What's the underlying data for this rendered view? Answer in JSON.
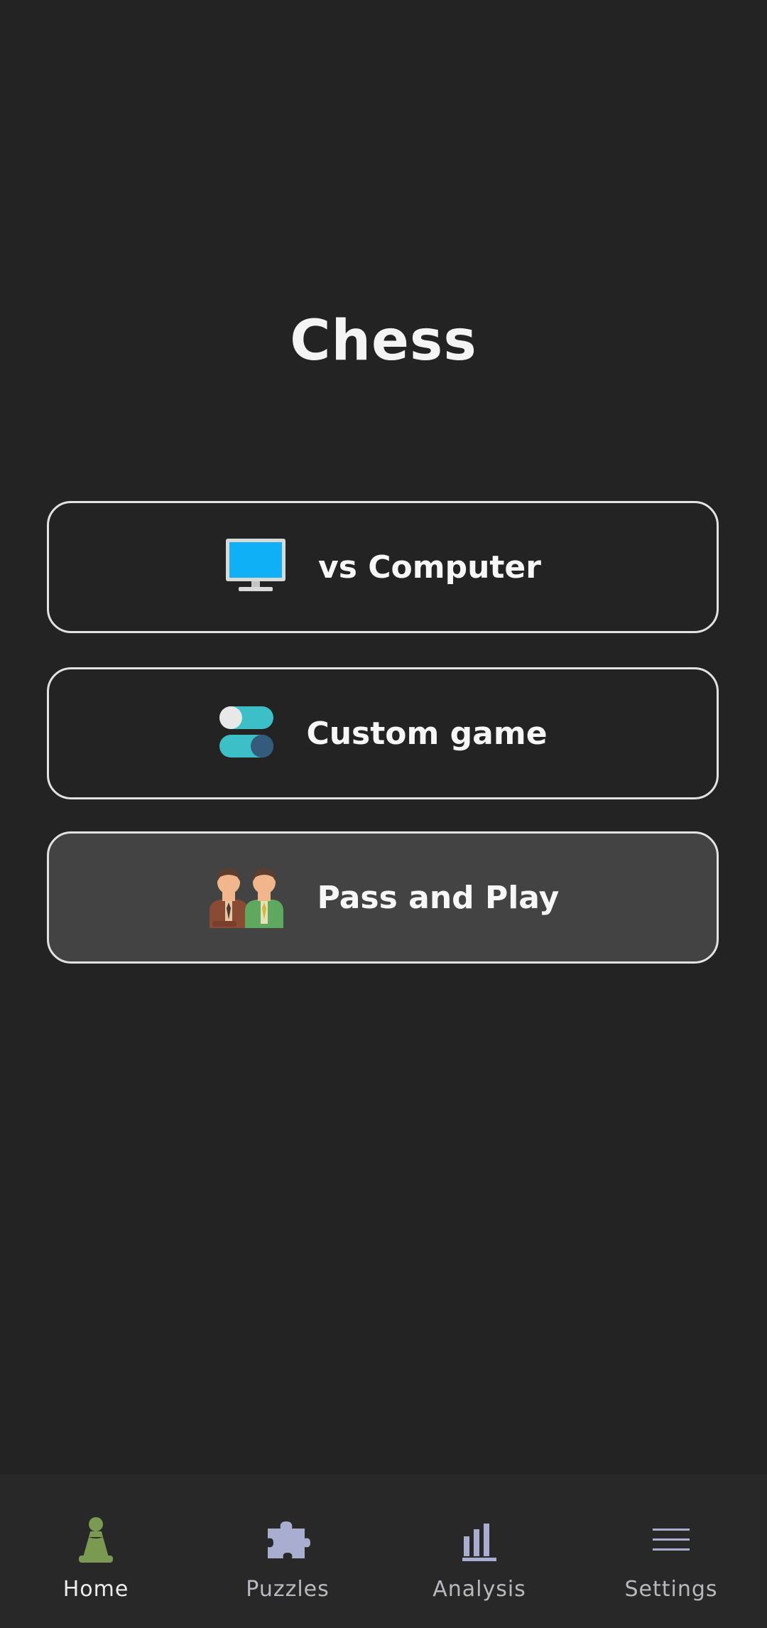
{
  "app": {
    "title": "Chess"
  },
  "menu": {
    "items": [
      {
        "label": "vs Computer",
        "icon": "computer-monitor-icon"
      },
      {
        "label": "Custom game",
        "icon": "toggle-switches-icon"
      },
      {
        "label": "Pass and Play",
        "icon": "two-people-icon",
        "highlighted": true
      }
    ]
  },
  "nav": {
    "items": [
      {
        "label": "Home",
        "icon": "pawn-icon",
        "selected": true
      },
      {
        "label": "Puzzles",
        "icon": "puzzle-piece-icon"
      },
      {
        "label": "Analysis",
        "icon": "bar-chart-icon"
      },
      {
        "label": "Settings",
        "icon": "hamburger-menu-icon"
      }
    ]
  },
  "colors": {
    "background": "#232323",
    "button_border": "#e2e2e2",
    "button_highlight": "#434343",
    "nav_background": "#282829",
    "home_icon": "#7a9a52",
    "nav_icon": "#a9adcf",
    "monitor_screen": "#0fb0f5",
    "toggle_teal": "#3cbfc6"
  }
}
